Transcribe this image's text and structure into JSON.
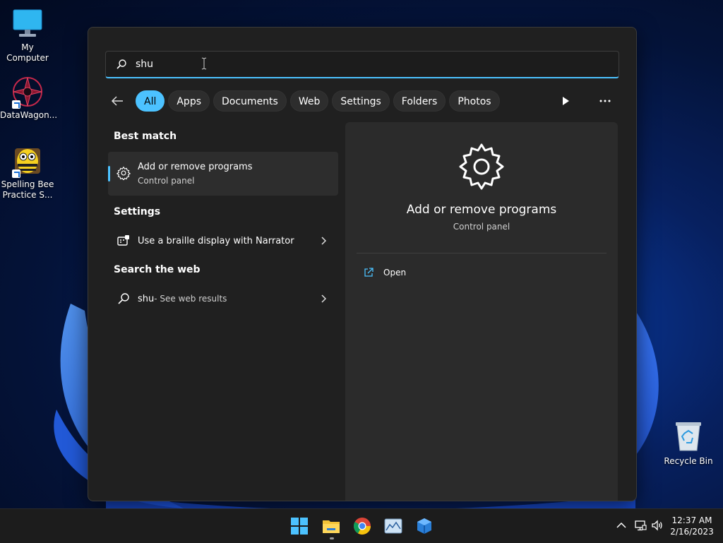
{
  "desktop": {
    "icons": [
      {
        "label": "My Computer"
      },
      {
        "label": "DataWagon..."
      },
      {
        "label_line1": "Spelling Bee",
        "label_line2": "Practice S..."
      }
    ],
    "recycle_bin": "Recycle Bin"
  },
  "search": {
    "query": "shu",
    "filters": [
      "All",
      "Apps",
      "Documents",
      "Web",
      "Settings",
      "Folders",
      "Photos"
    ],
    "active_filter": "All"
  },
  "results": {
    "best_match_header": "Best match",
    "best_match": {
      "title": "Add or remove programs",
      "subtitle": "Control panel"
    },
    "settings_header": "Settings",
    "settings_item": "Use a braille display with Narrator",
    "web_header": "Search the web",
    "web_item": {
      "query": "shu",
      "suffix": " - See web results"
    }
  },
  "detail": {
    "title": "Add or remove programs",
    "subtitle": "Control panel",
    "action_open": "Open"
  },
  "taskbar": {
    "time": "12:37 AM",
    "date": "2/16/2023"
  },
  "colors": {
    "accent": "#4cc2ff",
    "flyout_bg": "#202020",
    "pane_bg": "#2b2b2b"
  }
}
